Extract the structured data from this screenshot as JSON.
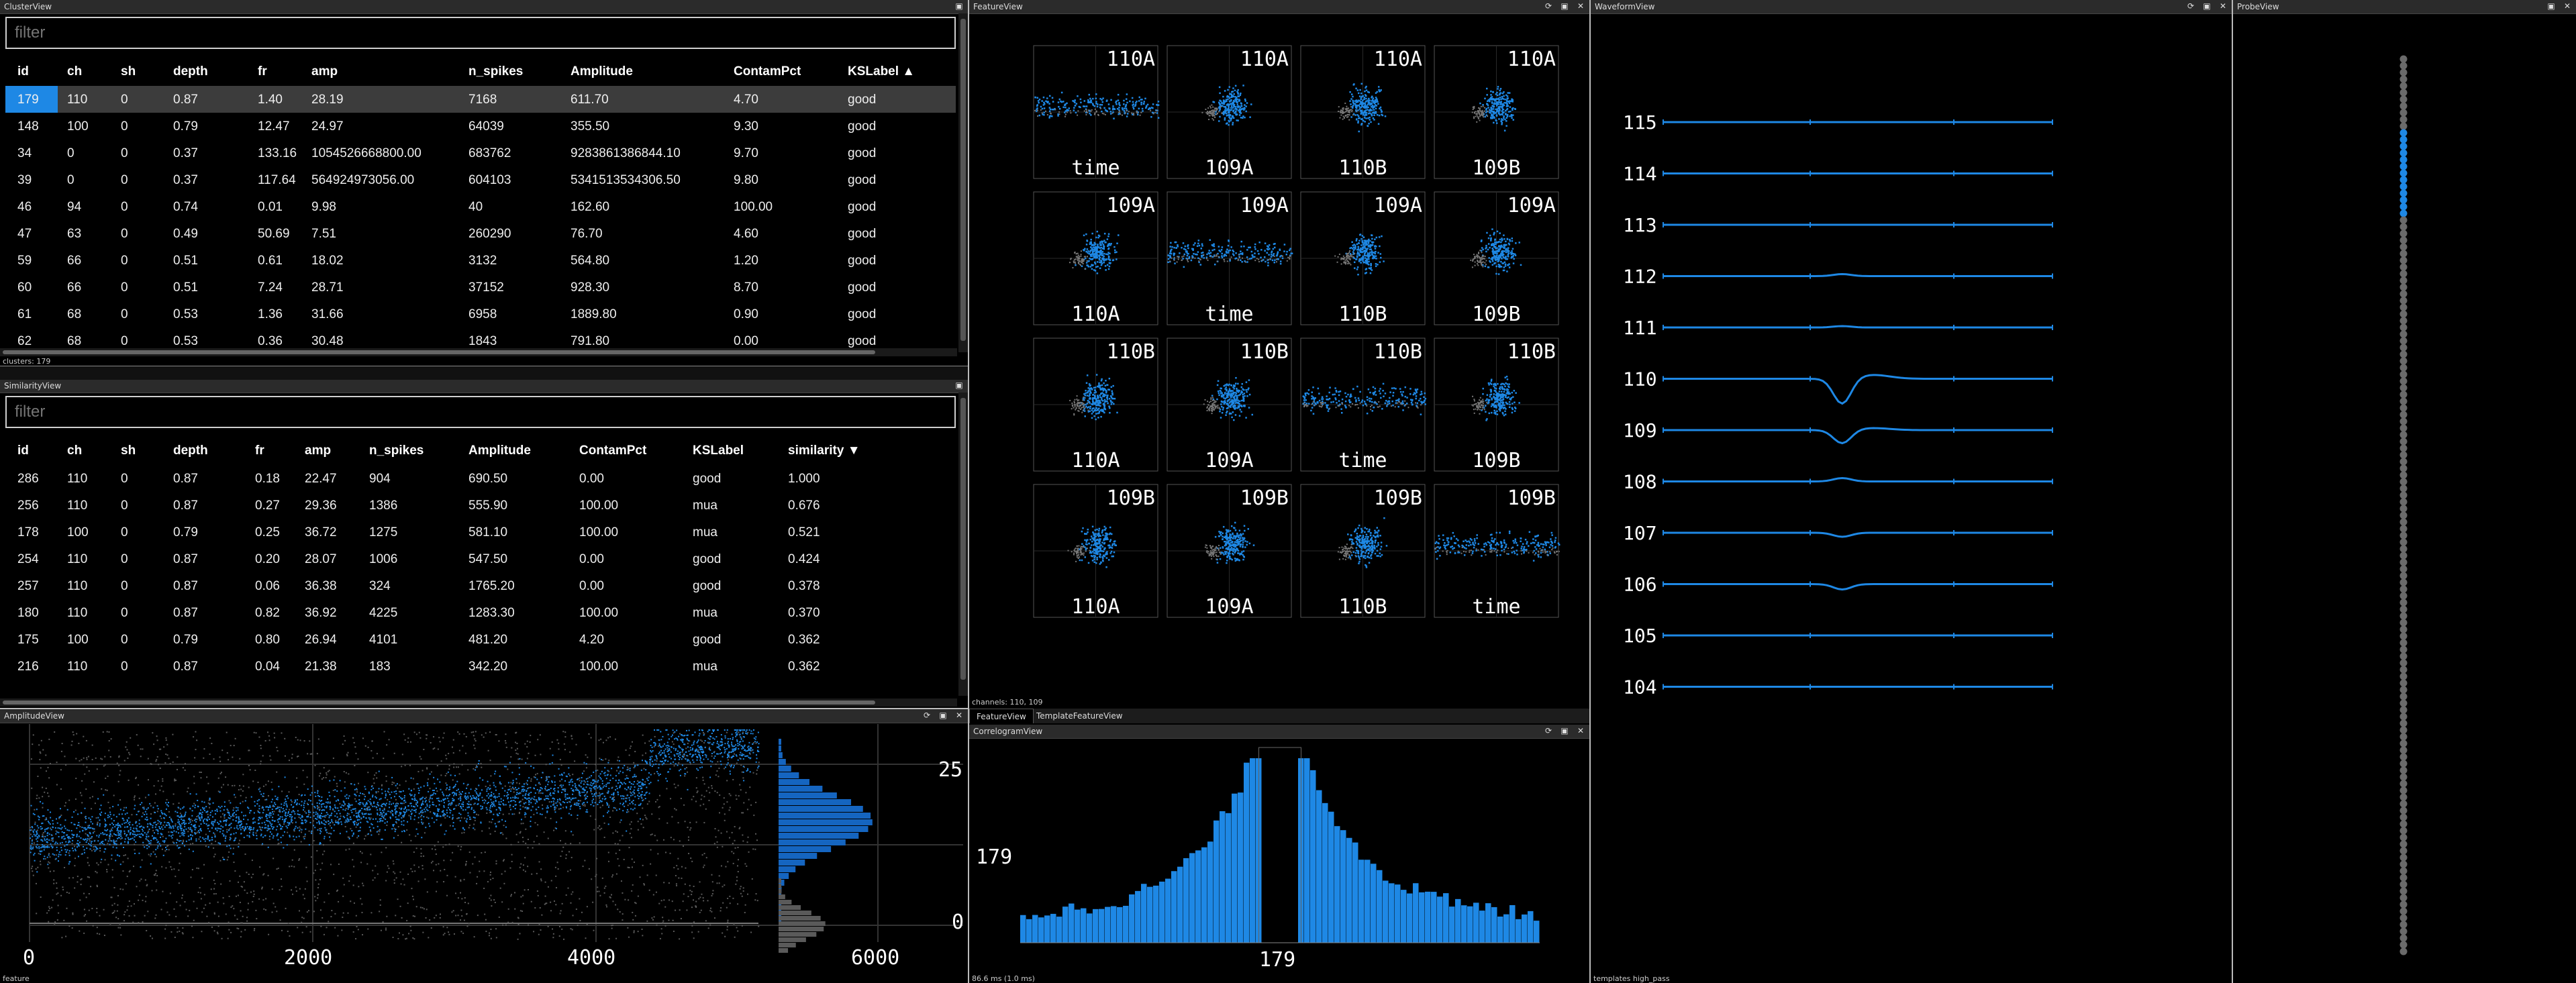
{
  "colors": {
    "accent": "#1e88e5",
    "grey": "#888888",
    "titlebar": "#2b2b2b"
  },
  "cluster_view": {
    "title": "ClusterView",
    "filter_placeholder": "filter",
    "columns": [
      "id",
      "ch",
      "sh",
      "depth",
      "fr",
      "amp",
      "n_spikes",
      "Amplitude",
      "ContamPct",
      "KSLabel ▲"
    ],
    "rows": [
      [
        "179",
        "110",
        "0",
        "0.87",
        "1.40",
        "28.19",
        "7168",
        "611.70",
        "4.70",
        "good"
      ],
      [
        "148",
        "100",
        "0",
        "0.79",
        "12.47",
        "24.97",
        "64039",
        "355.50",
        "9.30",
        "good"
      ],
      [
        "34",
        "0",
        "0",
        "0.37",
        "133.16",
        "1054526668800.00",
        "683762",
        "9283861386844.10",
        "9.70",
        "good"
      ],
      [
        "39",
        "0",
        "0",
        "0.37",
        "117.64",
        "564924973056.00",
        "604103",
        "5341513534306.50",
        "9.80",
        "good"
      ],
      [
        "46",
        "94",
        "0",
        "0.74",
        "0.01",
        "9.98",
        "40",
        "162.60",
        "100.00",
        "good"
      ],
      [
        "47",
        "63",
        "0",
        "0.49",
        "50.69",
        "7.51",
        "260290",
        "76.70",
        "4.60",
        "good"
      ],
      [
        "59",
        "66",
        "0",
        "0.51",
        "0.61",
        "18.02",
        "3132",
        "564.80",
        "1.20",
        "good"
      ],
      [
        "60",
        "66",
        "0",
        "0.51",
        "7.24",
        "28.71",
        "37152",
        "928.30",
        "8.70",
        "good"
      ],
      [
        "61",
        "68",
        "0",
        "0.53",
        "1.36",
        "31.66",
        "6958",
        "1889.80",
        "0.90",
        "good"
      ],
      [
        "62",
        "68",
        "0",
        "0.53",
        "0.36",
        "30.48",
        "1843",
        "791.80",
        "0.00",
        "good"
      ]
    ],
    "status": "clusters: 179"
  },
  "similarity_view": {
    "title": "SimilarityView",
    "filter_placeholder": "filter",
    "columns": [
      "id",
      "ch",
      "sh",
      "depth",
      "fr",
      "amp",
      "n_spikes",
      "Amplitude",
      "ContamPct",
      "KSLabel",
      "similarity ▼"
    ],
    "rows": [
      [
        "286",
        "110",
        "0",
        "0.87",
        "0.18",
        "22.47",
        "904",
        "690.50",
        "0.00",
        "good",
        "1.000"
      ],
      [
        "256",
        "110",
        "0",
        "0.87",
        "0.27",
        "29.36",
        "1386",
        "555.90",
        "100.00",
        "mua",
        "0.676"
      ],
      [
        "178",
        "100",
        "0",
        "0.79",
        "0.25",
        "36.72",
        "1275",
        "581.10",
        "100.00",
        "mua",
        "0.521"
      ],
      [
        "254",
        "110",
        "0",
        "0.87",
        "0.20",
        "28.07",
        "1006",
        "547.50",
        "0.00",
        "good",
        "0.424"
      ],
      [
        "257",
        "110",
        "0",
        "0.87",
        "0.06",
        "36.38",
        "324",
        "1765.20",
        "0.00",
        "good",
        "0.378"
      ],
      [
        "180",
        "110",
        "0",
        "0.87",
        "0.82",
        "36.92",
        "4225",
        "1283.30",
        "100.00",
        "mua",
        "0.370"
      ],
      [
        "175",
        "100",
        "0",
        "0.79",
        "0.80",
        "26.94",
        "4101",
        "481.20",
        "4.20",
        "good",
        "0.362"
      ],
      [
        "216",
        "110",
        "0",
        "0.87",
        "0.04",
        "21.38",
        "183",
        "342.20",
        "100.00",
        "mua",
        "0.362"
      ]
    ]
  },
  "amplitude_view": {
    "title": "AmplitudeView",
    "x_ticks": [
      "0",
      "2000",
      "4000",
      "6000"
    ],
    "y_ticks": [
      "25",
      "0"
    ],
    "status": "feature"
  },
  "feature_view": {
    "title": "FeatureView",
    "grid": [
      [
        [
          "110A",
          "time"
        ],
        [
          "110A",
          "109A"
        ],
        [
          "110A",
          "110B"
        ],
        [
          "110A",
          "109B"
        ]
      ],
      [
        [
          "109A",
          "110A"
        ],
        [
          "109A",
          "time"
        ],
        [
          "109A",
          "110B"
        ],
        [
          "109A",
          "109B"
        ]
      ],
      [
        [
          "110B",
          "110A"
        ],
        [
          "110B",
          "109A"
        ],
        [
          "110B",
          "time"
        ],
        [
          "110B",
          "109B"
        ]
      ],
      [
        [
          "109B",
          "110A"
        ],
        [
          "109B",
          "109A"
        ],
        [
          "109B",
          "110B"
        ],
        [
          "109B",
          "time"
        ]
      ]
    ],
    "status": "channels: 110, 109",
    "tabs": [
      "FeatureView",
      "TemplateFeatureView"
    ]
  },
  "correlogram_view": {
    "title": "CorrelogramView",
    "label_left": "179",
    "label_bottom": "179",
    "status": "86.6 ms (1.0 ms)"
  },
  "waveform_view": {
    "title": "WaveformView",
    "channels": [
      "115",
      "114",
      "113",
      "112",
      "111",
      "110",
      "109",
      "108",
      "107",
      "106",
      "105",
      "104"
    ],
    "status": "templates high_pass"
  },
  "probe_view": {
    "title": "ProbeView"
  }
}
